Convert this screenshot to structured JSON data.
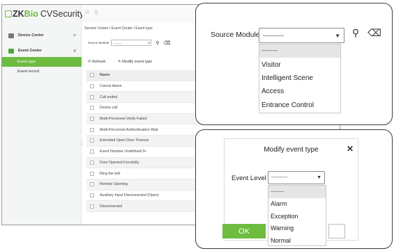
{
  "brand": {
    "zk": "ZK",
    "bio": "Bio",
    "product": "CVSecurity"
  },
  "sidebar": {
    "items": [
      {
        "label": "Device Center",
        "chevron": ">"
      },
      {
        "label": "Event Center",
        "chevron": "v"
      }
    ],
    "sub_items": [
      {
        "label": "Event type",
        "active": true
      },
      {
        "label": "Event record",
        "active": false
      }
    ],
    "splitter": "‹"
  },
  "topbar": {
    "apps_glyph": "⁞⁞⁞",
    "collapse_glyph": "⁞⁞"
  },
  "main": {
    "breadcrumb": "Service Center / Event Center / Event type",
    "filter": {
      "label": "Source Module",
      "value": "---------",
      "arrow": "▾"
    },
    "toolbar": {
      "refresh": "Refresh",
      "modify": "Modify event type"
    },
    "grid": {
      "header": "Name",
      "rows": [
        "Cancel Alarm",
        "Call ended",
        "Device call",
        "Multi-Personnel Verify Failed",
        "Multi-Personnel Authentication Wait",
        "Extended Open Door Timeout",
        "Event Number Undefined-3+",
        "Door Opened Forcefully",
        "Ring the bell",
        "Remote Opening",
        "Auxiliary Input Disconnected (Open)",
        "Disconnected"
      ]
    }
  },
  "source_module_zoom": {
    "label": "Source Module",
    "value": "----------",
    "arrow": "▼",
    "search_glyph": "⚲",
    "clear_glyph": "⌫",
    "options": [
      "----------",
      "Visitor",
      "Intelligent Scene",
      "Access",
      "Entrance Control"
    ]
  },
  "modify_dialog": {
    "title": "Modify event type",
    "close": "✕",
    "event_level_label": "Event Level",
    "event_level_value": "----------",
    "arrow": "▼",
    "options": [
      "----------",
      "Alarm",
      "Exception",
      "Warning",
      "Normal"
    ],
    "ok_label": "OK"
  },
  "colors": {
    "accent": "#6dbb3f",
    "border": "#3a3a3a",
    "selected_bg": "#e6e6e6"
  }
}
